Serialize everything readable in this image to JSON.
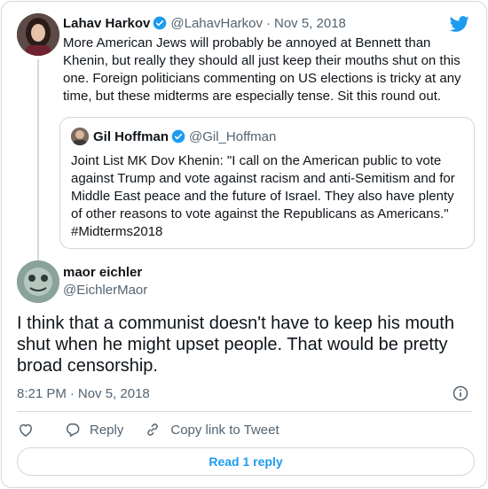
{
  "colors": {
    "accent": "#1d9bf0",
    "muted": "#536471",
    "border": "#cfd9de",
    "text": "#0f1419"
  },
  "parent_tweet": {
    "name": "Lahav Harkov",
    "handle": "@LahavHarkov",
    "separator": "·",
    "date": "Nov 5, 2018",
    "text": "More American Jews will probably be annoyed at Bennett than Khenin, but really they should all just keep their mouths shut on this one. Foreign politicians commenting on US elections is tricky at any time, but these midterms are especially tense. Sit this round out."
  },
  "quoted_tweet": {
    "name": "Gil Hoffman",
    "handle": "@Gil_Hoffman",
    "text": "Joint List MK Dov Khenin: \"I call on the American public to vote against Trump and vote against racism and anti-Semitism and for Middle East peace and the future of Israel. They also have plenty of other reasons to vote against the Republicans as Americans.\" #Midterms2018"
  },
  "main_tweet": {
    "name": "maor eichler",
    "handle": "@EichlerMaor",
    "text": "I think that a communist doesn't have to keep his mouth shut when he might upset people. That would be pretty broad censorship.",
    "time": "8:21 PM",
    "separator": "·",
    "date": "Nov 5, 2018"
  },
  "actions": {
    "reply_label": "Reply",
    "copy_link_label": "Copy link to Tweet"
  },
  "read_replies_label": "Read 1 reply",
  "icons": [
    "twitter-bird-icon",
    "verified-badge-icon",
    "info-icon",
    "heart-icon",
    "reply-icon",
    "link-icon"
  ]
}
